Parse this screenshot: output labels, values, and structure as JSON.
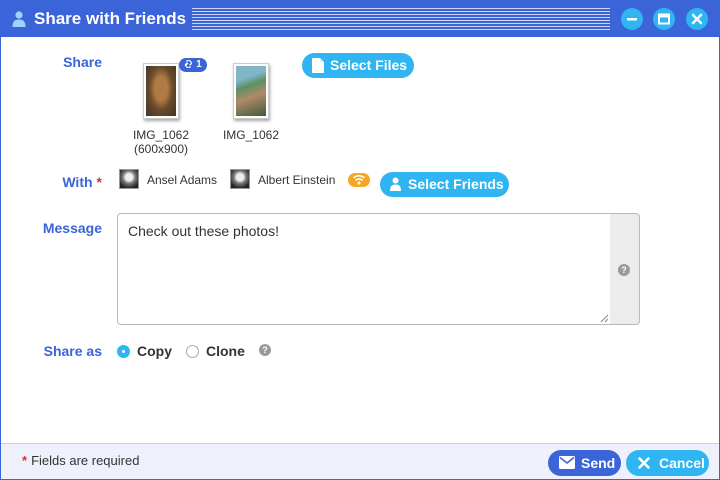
{
  "window": {
    "title": "Share with Friends"
  },
  "share": {
    "label": "Share",
    "files": [
      {
        "name": "IMG_1062",
        "dims": "(600x900)",
        "badge": "1"
      },
      {
        "name": "IMG_1062",
        "dims": ""
      }
    ],
    "select_files_label": "Select Files"
  },
  "with": {
    "label": "With",
    "required_mark": "*",
    "friends": [
      {
        "name": "Ansel Adams"
      },
      {
        "name": "Albert Einstein"
      }
    ],
    "select_friends_label": "Select Friends"
  },
  "message": {
    "label": "Message",
    "value": "Check out these photos!"
  },
  "share_as": {
    "label": "Share as",
    "options": [
      {
        "label": "Copy",
        "selected": true
      },
      {
        "label": "Clone",
        "selected": false
      }
    ]
  },
  "footer": {
    "required_mark": "*",
    "note": "Fields are required",
    "send_label": "Send",
    "cancel_label": "Cancel"
  },
  "colors": {
    "primary": "#3a64d8",
    "accent": "#2fb5f2",
    "required": "#d0343a",
    "rss": "#f5a623"
  },
  "icons": [
    "user-icon",
    "minimize-icon",
    "maximize-icon",
    "close-icon",
    "file-icon",
    "link-icon",
    "rss-icon",
    "help-icon",
    "envelope-icon"
  ]
}
